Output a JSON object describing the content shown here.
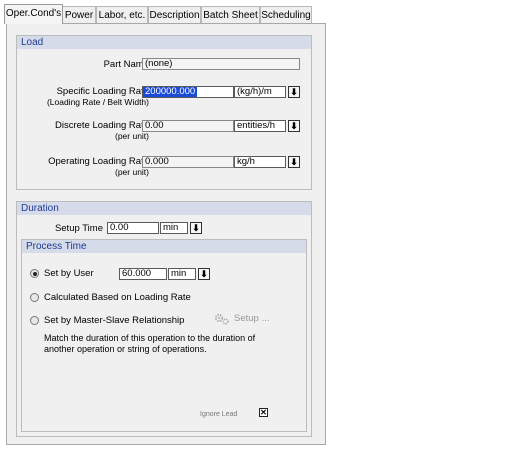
{
  "tabs": [
    "Oper.Cond's",
    "Power",
    "Labor, etc.",
    "Description",
    "Batch Sheet",
    "Scheduling"
  ],
  "load": {
    "header": "Load",
    "part_name_label": "Part Name",
    "part_name_value": "(none)",
    "specific_label": "Specific Loading Rate",
    "specific_sublabel": "(Loading Rate / Belt Width)",
    "specific_value": "200000.000",
    "specific_unit": "(kg/h)/m",
    "discrete_label": "Discrete Loading Rate",
    "discrete_sublabel": "(per unit)",
    "discrete_value": "0.00",
    "discrete_unit": "entities/h",
    "operating_label": "Operating Loading Rate",
    "operating_sublabel": "(per unit)",
    "operating_value": "0.000",
    "operating_unit": "kg/h"
  },
  "duration": {
    "header": "Duration",
    "setup_label": "Setup Time",
    "setup_value": "0.00",
    "setup_unit": "min"
  },
  "process_time": {
    "header": "Process Time",
    "options": {
      "set_by_user": "Set by User",
      "calculated": "Calculated Based on Loading Rate",
      "master_slave": "Set by Master-Slave Relationship"
    },
    "selected": "set_by_user",
    "user_value": "60.000",
    "user_unit": "min",
    "setup_button": "Setup ...",
    "description": [
      "Match the duration of this operation to the duration of",
      "another operation or string of operations."
    ],
    "ignore_label": "Ignore Lead",
    "ignore_checked": true
  },
  "icons": {
    "dropdown": "arrow-down-icon",
    "setup": "gears-icon"
  }
}
